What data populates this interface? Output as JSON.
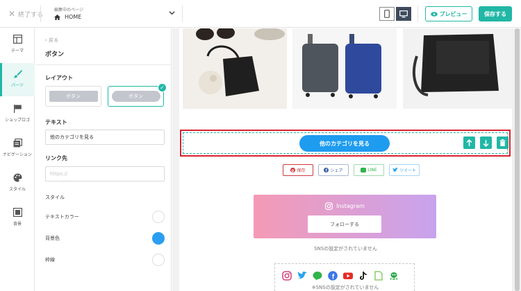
{
  "topbar": {
    "exit_label": "終了する",
    "page_caption": "編集中のページ",
    "page_name": "HOME",
    "preview_label": "プレビュー",
    "save_label": "保存する"
  },
  "rail": [
    {
      "label": "テーマ",
      "icon": "layout-icon"
    },
    {
      "label": "パーツ",
      "icon": "brush-icon",
      "active": true
    },
    {
      "label": "ショップロゴ",
      "icon": "flag-icon"
    },
    {
      "label": "ナビゲーション",
      "icon": "navigation-icon"
    },
    {
      "label": "スタイル",
      "icon": "palette-icon"
    },
    {
      "label": "背景",
      "icon": "background-icon"
    }
  ],
  "panel": {
    "back_label": "戻る",
    "title": "ボタン",
    "layout_label": "レイアウト",
    "layout_options": [
      "ボタン",
      "ボタン"
    ],
    "text_label": "テキスト",
    "text_value": "他のカテゴリを見る",
    "link_label": "リンク先",
    "link_placeholder": "https://",
    "style_label": "スタイル",
    "style_rows": [
      {
        "label": "テキストカラー",
        "color": "#ffffff"
      },
      {
        "label": "背景色",
        "color": "#2a9ef0"
      },
      {
        "label": "枠線",
        "color": "#ffffff"
      }
    ]
  },
  "preview": {
    "category_button": "他のカテゴリを見る",
    "share_buttons": [
      {
        "label": "保存",
        "icon": "pinterest-icon",
        "color": "#d0393e"
      },
      {
        "label": "シェア",
        "icon": "facebook-icon",
        "color": "#3b5ea7"
      },
      {
        "label": "LINE",
        "icon": "line-icon",
        "color": "#2fb54a"
      },
      {
        "label": "ツイート",
        "icon": "twitter-icon",
        "color": "#2aa3ef"
      }
    ],
    "instagram_title": "Instagram",
    "follow_label": "フォローする",
    "sns_notice": "SNSの設定がされていません",
    "sns_notice2": "※SNSの設定がされていません",
    "sns_icons": [
      "instagram-icon",
      "twitter-icon",
      "line-icon",
      "facebook-icon",
      "youtube-icon",
      "tiktok-icon",
      "note-icon",
      "ameba-icon"
    ]
  },
  "colors": {
    "accent": "#21b7a6",
    "button_blue": "#1e9cf0",
    "selection_red": "#d9232e"
  }
}
